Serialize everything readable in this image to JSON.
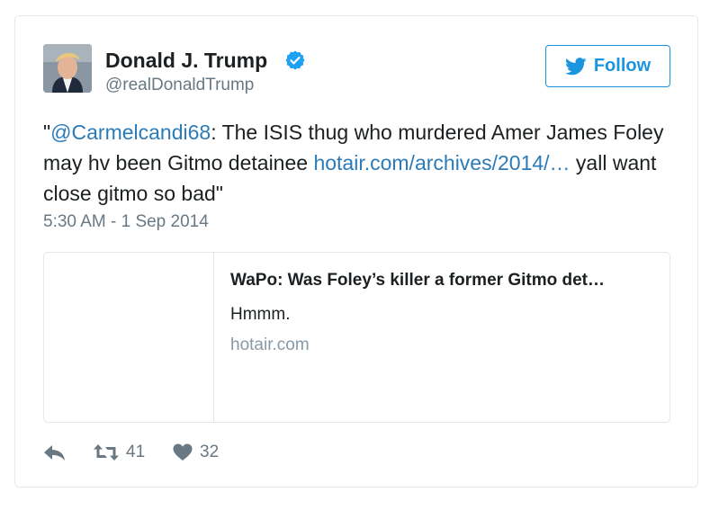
{
  "header": {
    "name": "Donald J. Trump",
    "handle": "@realDonaldTrump",
    "follow_label": "Follow"
  },
  "tweet": {
    "quote_open": "\"",
    "mention": "@Carmelcandi68",
    "text_1": ": The ISIS thug who murdered Amer James Foley may hv been Gitmo detainee ",
    "link": "hotair.com/archives/2014/…",
    "text_2": " yall want close gitmo so bad\"",
    "timestamp": "5:30 AM - 1 Sep 2014"
  },
  "card": {
    "title": "WaPo: Was Foley’s killer a former Gitmo det…",
    "description": "Hmmm.",
    "domain": "hotair.com"
  },
  "actions": {
    "retweets": "41",
    "likes": "32"
  },
  "colors": {
    "accent": "#1b95e0",
    "link": "#2b7bb9",
    "muted": "#697882",
    "verified": "#1da1f2"
  },
  "icons": {
    "verified": "verified-badge-icon",
    "follow": "twitter-bird-icon",
    "reply": "reply-icon",
    "retweet": "retweet-icon",
    "like": "heart-icon"
  }
}
